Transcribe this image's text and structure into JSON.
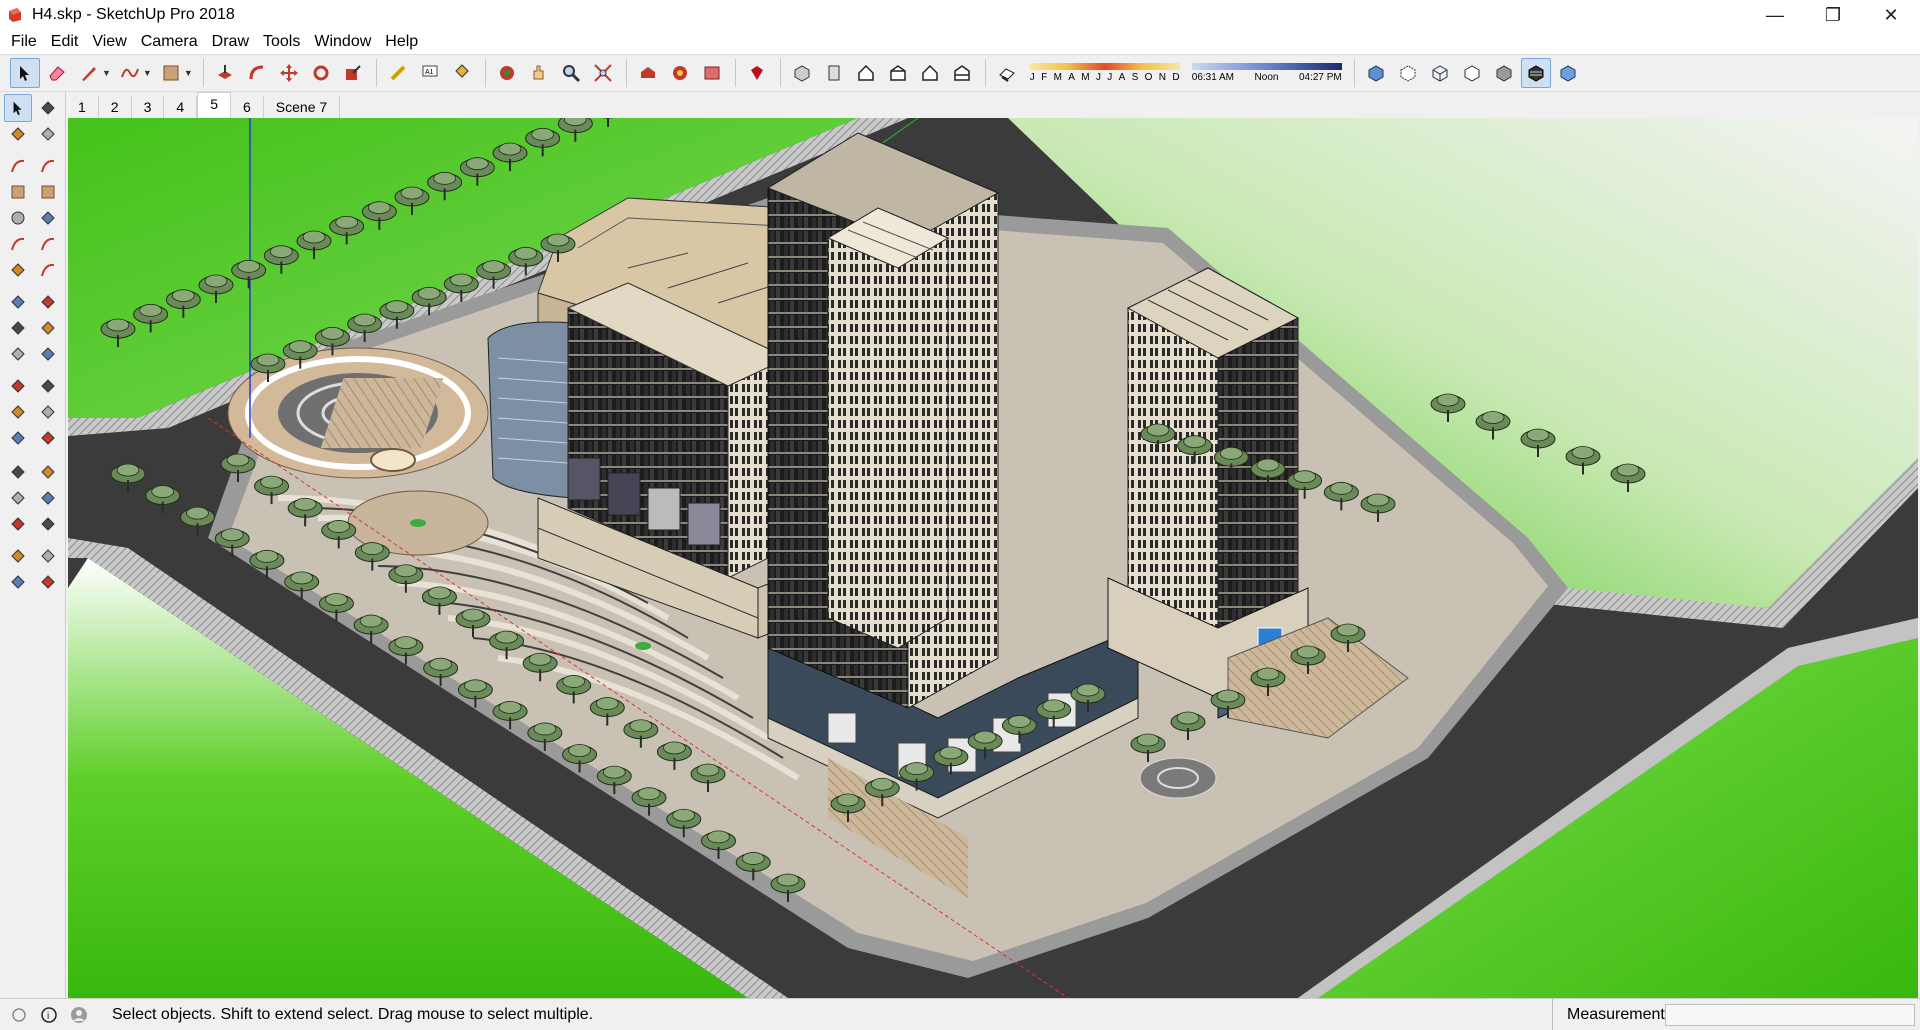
{
  "window": {
    "title": "H4.skp - SketchUp Pro 2018",
    "controls": [
      "minimize-icon",
      "restore-icon",
      "close-icon"
    ]
  },
  "menu": [
    "File",
    "Edit",
    "View",
    "Camera",
    "Draw",
    "Tools",
    "Window",
    "Help"
  ],
  "toolbar": {
    "tools": [
      "select-icon",
      "eraser-icon",
      "pencil-icon",
      "freehand-icon",
      "rectangle-icon",
      "push-pull-icon",
      "follow-me-icon",
      "move-icon",
      "rotate-icon",
      "scale-icon",
      "tape-measure-icon",
      "text-icon",
      "paint-bucket-icon",
      "orbit-icon",
      "pan-icon",
      "zoom-icon",
      "zoom-extents-icon",
      "warehouse-icon",
      "extension-warehouse-icon",
      "layout-icon",
      "ruby-icon",
      "iso-view-icon",
      "front-view-icon",
      "top-view-icon",
      "right-view-icon",
      "back-view-icon",
      "left-view-icon",
      "shadows-toggle-icon"
    ],
    "months": [
      "J",
      "F",
      "M",
      "A",
      "M",
      "J",
      "J",
      "A",
      "S",
      "O",
      "N",
      "D"
    ],
    "time_start": "06:31 AM",
    "time_mid": "Noon",
    "time_end": "04:27 PM",
    "style_tools": [
      "xray-icon",
      "back-edges-icon",
      "wireframe-icon",
      "hidden-line-icon",
      "shaded-icon",
      "shaded-textures-icon",
      "monochrome-icon"
    ]
  },
  "scenes": [
    "1",
    "2",
    "3",
    "4",
    "5",
    "6",
    "Scene 7"
  ],
  "active_scene": "5",
  "left_tools": [
    "select-icon",
    "make-component-icon",
    "paint-bucket-icon",
    "eraser-icon",
    "line-icon",
    "freehand-icon",
    "rectangle-icon",
    "rotated-rectangle-icon",
    "circle-icon",
    "polygon-icon",
    "arc-icon",
    "two-point-arc-icon",
    "pie-icon",
    "three-point-arc-icon",
    "move-icon",
    "push-pull-icon",
    "rotate-icon",
    "follow-me-icon",
    "scale-icon",
    "offset-icon",
    "tape-measure-icon",
    "dimension-icon",
    "protractor-icon",
    "text-icon",
    "axes-icon",
    "3d-text-icon",
    "orbit-icon",
    "pan-icon",
    "zoom-icon",
    "zoom-window-icon",
    "zoom-extents-icon",
    "previous-view-icon",
    "position-camera-icon",
    "look-around-icon",
    "walk-icon",
    "section-plane-icon"
  ],
  "status": {
    "message": "Select objects. Shift to extend select. Drag mouse to select multiple.",
    "measurements_label": "Measurements",
    "measurements_value": ""
  },
  "colors": {
    "grass": "#3fbf1a",
    "road": "#3a3a3a",
    "sidewalk": "#b8b8b8",
    "plaza": "#d8c4a4",
    "facade_dark": "#1e1e1e",
    "facade_light": "#d9d2c2"
  }
}
